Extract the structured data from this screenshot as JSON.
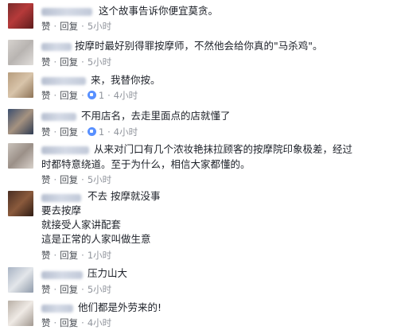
{
  "comments": [
    {
      "text": "这个故事告诉你便宜莫贪。",
      "actions": {
        "like": "赞",
        "reply": "回复",
        "time": "5小时"
      }
    },
    {
      "text": "按摩时最好别得罪按摩师，不然他会给你真的\"马杀鸡\"。",
      "actions": {
        "like": "赞",
        "reply": "回复",
        "time": "5小时"
      }
    },
    {
      "text": "来，我替你按。",
      "actions": {
        "like": "赞",
        "reply": "回复",
        "likes": "1",
        "time": "4小时"
      }
    },
    {
      "text": "不用店名，去走里面点的店就懂了",
      "actions": {
        "like": "赞",
        "reply": "回复",
        "likes": "1",
        "time": "4小时"
      }
    },
    {
      "text_line1": "从来对门口有几个浓妆艳抹拉顾客的按摩院印象极差，经过",
      "text_line2": "时都特意绕道。至于为什么，相信大家都懂的。",
      "actions": {
        "like": "赞",
        "reply": "回复",
        "time": "5小时"
      }
    },
    {
      "text": "不去 按摩就没事",
      "lines": [
        "要去按摩",
        "就接受人家讲配套",
        "這是正常的人家叫做生意"
      ],
      "actions": {
        "like": "赞",
        "reply": "回复",
        "time": "1小时"
      }
    },
    {
      "text": "压力山大",
      "actions": {
        "like": "赞",
        "reply": "回复",
        "time": "5小时"
      }
    },
    {
      "text": "他们都是外劳来的!",
      "actions": {
        "like": "赞",
        "reply": "回复",
        "time": "4小时"
      }
    }
  ],
  "colors": {
    "like_badge": "#5890ff",
    "meta": "#90949c",
    "text": "#1d2129"
  }
}
